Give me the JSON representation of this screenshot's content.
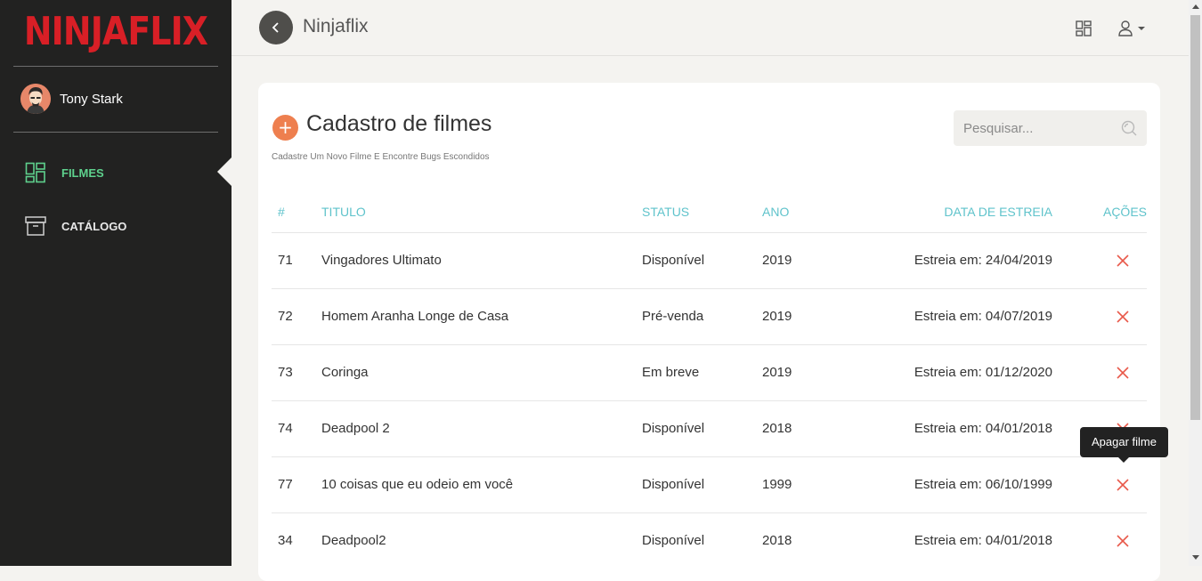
{
  "brand": {
    "logo_text": "NINJAFLIX",
    "logo_color": "#d81f26"
  },
  "sidebar": {
    "user_name": "Tony Stark",
    "items": [
      {
        "label": "FILMES",
        "icon": "dashboard-icon",
        "active": true
      },
      {
        "label": "CATÁLOGO",
        "icon": "archive-box-icon",
        "active": false
      }
    ]
  },
  "header": {
    "title": "Ninjaflix",
    "back_icon": "chevron-left-icon",
    "grid_icon": "layout-grid-icon",
    "user_icon": "user-icon"
  },
  "page": {
    "title": "Cadastro de filmes",
    "subtitle": "Cadastre Um Novo Filme E Encontre Bugs Escondidos",
    "search_placeholder": "Pesquisar..."
  },
  "table": {
    "columns": [
      "#",
      "TITULO",
      "STATUS",
      "ANO",
      "DATA DE ESTREIA",
      "AÇÕES"
    ],
    "rows": [
      {
        "id": "71",
        "title": "Vingadores Ultimato",
        "status": "Disponível",
        "year": "2019",
        "premiere": "Estreia em: 24/04/2019"
      },
      {
        "id": "72",
        "title": "Homem Aranha Longe de Casa",
        "status": "Pré-venda",
        "year": "2019",
        "premiere": "Estreia em: 04/07/2019"
      },
      {
        "id": "73",
        "title": "Coringa",
        "status": "Em breve",
        "year": "2019",
        "premiere": "Estreia em: 01/12/2020"
      },
      {
        "id": "74",
        "title": "Deadpool 2",
        "status": "Disponível",
        "year": "2018",
        "premiere": "Estreia em: 04/01/2018"
      },
      {
        "id": "77",
        "title": "10 coisas que eu odeio em você",
        "status": "Disponível",
        "year": "1999",
        "premiere": "Estreia em: 06/10/1999"
      },
      {
        "id": "34",
        "title": "Deadpool2",
        "status": "Disponível",
        "year": "2018",
        "premiere": "Estreia em: 04/01/2018"
      }
    ]
  },
  "tooltip": {
    "text": "Apagar filme"
  },
  "colors": {
    "accent_teal": "#5fc3cb",
    "accent_green": "#5ed18d",
    "add_orange": "#ee7f4f",
    "delete_red": "#e8594a"
  }
}
